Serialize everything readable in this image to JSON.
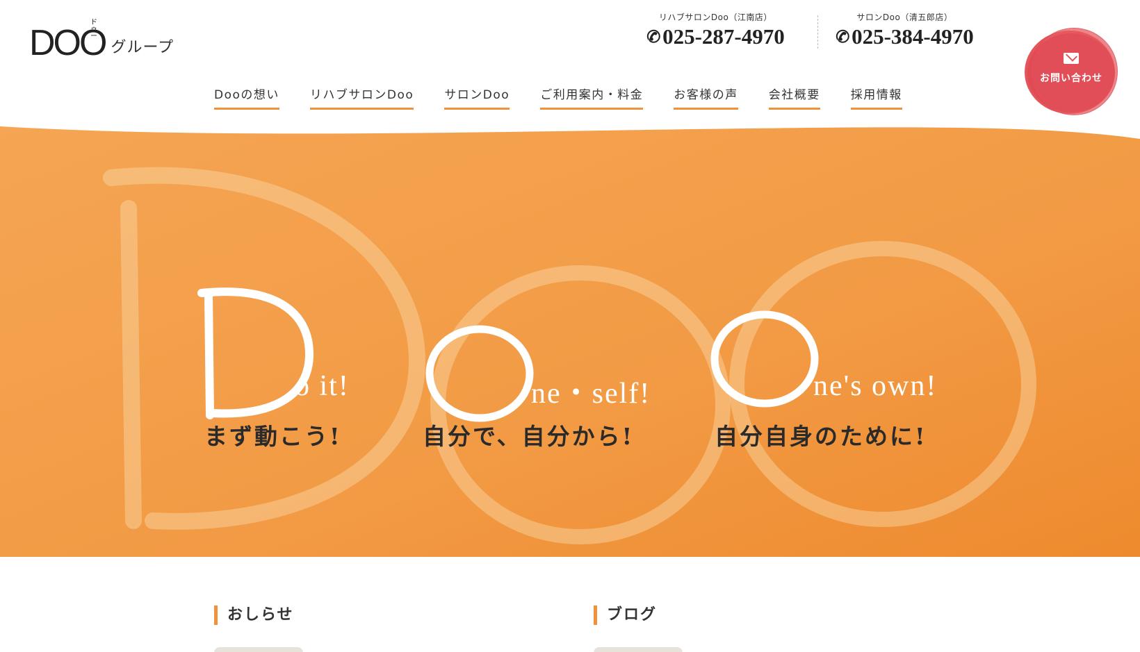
{
  "logo": {
    "mark": "DOO",
    "ruby": "ドゥー",
    "sub": "グループ"
  },
  "tels": [
    {
      "label": "リハブサロンDoo（江南店）",
      "number": "025-287-4970"
    },
    {
      "label": "サロンDoo（清五郎店）",
      "number": "025-384-4970"
    }
  ],
  "contact": {
    "label": "お問い合わせ"
  },
  "nav": [
    "Dooの想い",
    "リハブサロンDoo",
    "サロンDoo",
    "ご利用案内・料金",
    "お客様の声",
    "会社概要",
    "採用情報"
  ],
  "hero": {
    "colors": {
      "orange": "#f29a44",
      "orange_dark": "#ee8a2e",
      "cream": "#fbd9a8"
    },
    "words": [
      {
        "initial": "D",
        "rest": "o it!",
        "tagline": "まず動こう!"
      },
      {
        "initial": "O",
        "rest": "ne・self!",
        "tagline": "自分で、自分から!"
      },
      {
        "initial": "O",
        "rest": "ne's own!",
        "tagline": "自分自身のために!"
      }
    ]
  },
  "sections": {
    "news": "おしらせ",
    "blog": "ブログ"
  },
  "accent": "#f0923a"
}
